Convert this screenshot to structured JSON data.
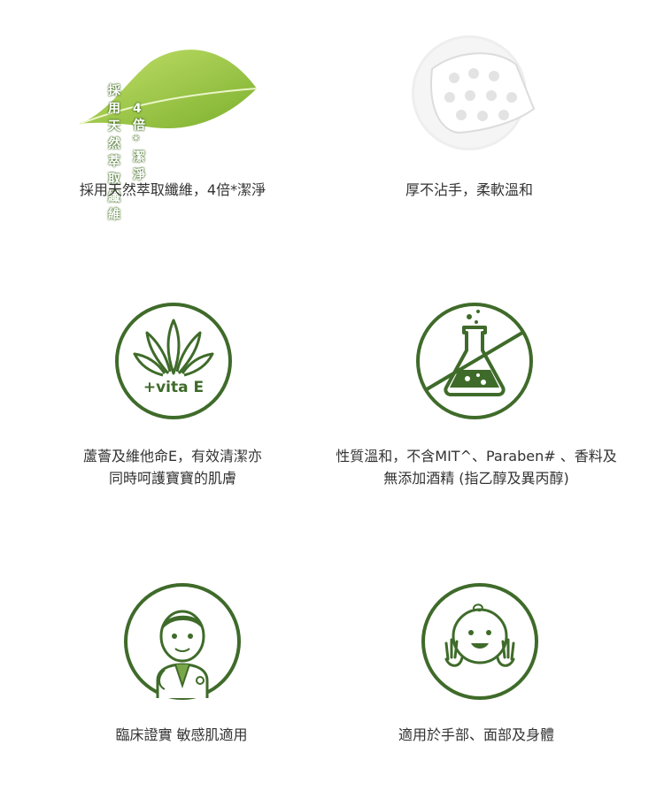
{
  "colors": {
    "accent": "#3f6b2a",
    "leaf_light": "#a8d14a",
    "leaf_dark": "#7cb02e",
    "text": "#333333"
  },
  "features": [
    {
      "icon": "leaf-icon",
      "badge_line1": "採用天然萃取纖維",
      "badge_line2": "4倍*潔淨",
      "caption_lines": [
        "採用天然萃取纖維，4倍*潔淨"
      ]
    },
    {
      "icon": "cotton-pad-icon",
      "caption_lines": [
        "厚不沾手，柔軟溫和"
      ]
    },
    {
      "icon": "aloe-vita-e-icon",
      "badge": "+vita E",
      "caption_lines": [
        "蘆薈及維他命E，有效清潔亦",
        "同時呵護寶寶的肌膚"
      ]
    },
    {
      "icon": "no-chemicals-flask-icon",
      "caption_lines": [
        "性質溫和，不含MIT^、Paraben# 、香料及",
        "無添加酒精 (指乙醇及異丙醇)"
      ]
    },
    {
      "icon": "doctor-icon",
      "caption_lines": [
        "臨床證實 敏感肌適用"
      ]
    },
    {
      "icon": "baby-face-icon",
      "caption_lines": [
        "適用於手部、面部及身體"
      ]
    }
  ]
}
